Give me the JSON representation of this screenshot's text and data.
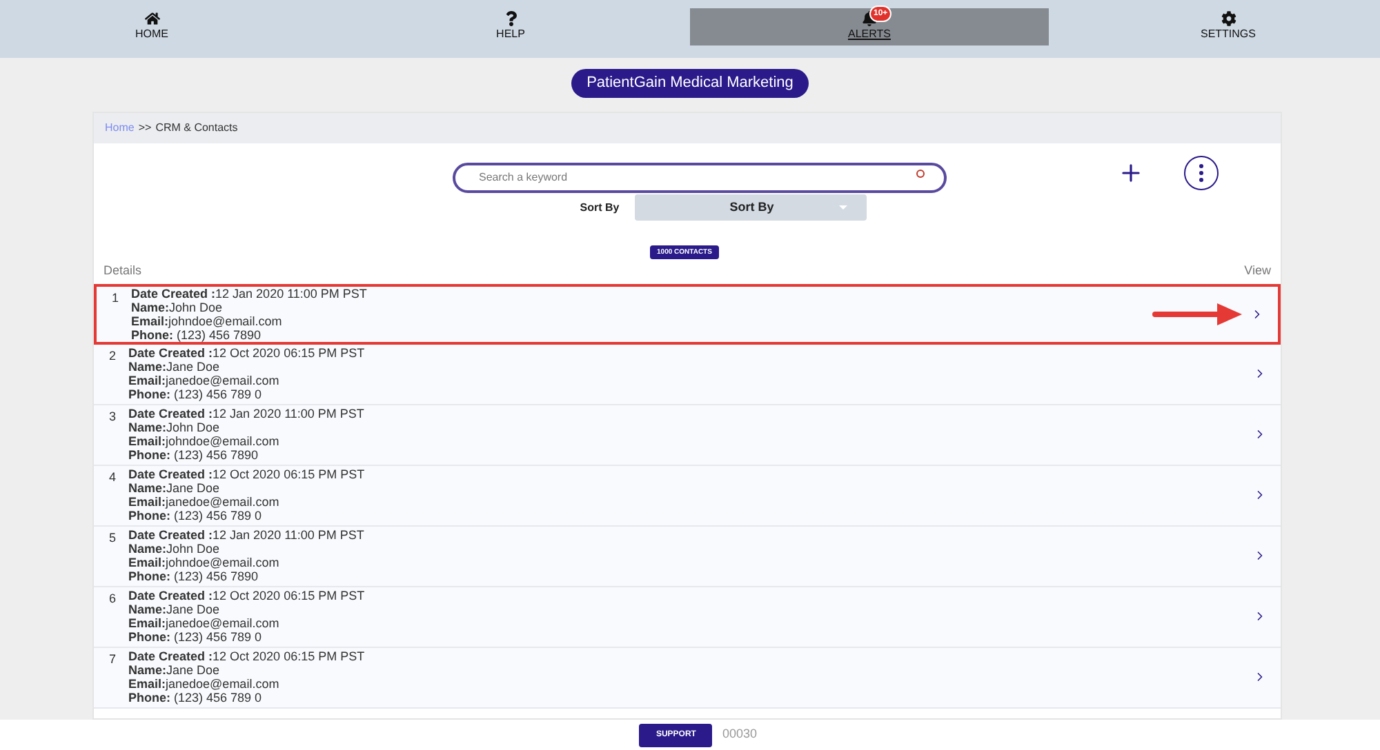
{
  "nav": [
    {
      "label": "HOME",
      "kind": "home",
      "selected": false
    },
    {
      "label": "HELP",
      "kind": "help",
      "selected": false
    },
    {
      "label": "ALERTS",
      "kind": "alerts",
      "selected": true,
      "badge": "10+"
    },
    {
      "label": "SETTINGS",
      "kind": "settings",
      "selected": false
    }
  ],
  "org_button": "PatientGain Medical Marketing",
  "breadcrumb": {
    "link": "Home",
    "separator": ">>",
    "current": "CRM & Contacts"
  },
  "search": {
    "placeholder": "Search a keyword"
  },
  "sort": {
    "label": "Sort By",
    "value": "Sort By"
  },
  "count_badge": "1000 CONTACTS",
  "columns": {
    "details": "Details",
    "view": "View"
  },
  "contacts": [
    {
      "index": "1",
      "date_label": "Date Created :",
      "date": "12 Jan 2020 11:00 PM PST",
      "name_label": "Name:",
      "name": "John Doe",
      "email_label": "Email:",
      "email": "johndoe@email.com",
      "phone_label": "Phone:",
      "phone": "(123) 456 7890",
      "selected": true
    },
    {
      "index": "2",
      "date_label": "Date Created :",
      "date": "12 Oct 2020 06:15 PM PST",
      "name_label": "Name:",
      "name": "Jane Doe",
      "email_label": "Email:",
      "email": "janedoe@email.com",
      "phone_label": "Phone:",
      "phone": "(123) 456 789 0",
      "selected": false
    },
    {
      "index": "3",
      "date_label": "Date Created :",
      "date": "12 Jan 2020 11:00 PM PST",
      "name_label": "Name:",
      "name": "John Doe",
      "email_label": "Email:",
      "email": "johndoe@email.com",
      "phone_label": "Phone:",
      "phone": "(123) 456 7890",
      "selected": false
    },
    {
      "index": "4",
      "date_label": "Date Created :",
      "date": "12 Oct 2020 06:15 PM PST",
      "name_label": "Name:",
      "name": "Jane Doe",
      "email_label": "Email:",
      "email": "janedoe@email.com",
      "phone_label": "Phone:",
      "phone": "(123) 456 789 0",
      "selected": false
    },
    {
      "index": "5",
      "date_label": "Date Created :",
      "date": "12 Jan 2020 11:00 PM PST",
      "name_label": "Name:",
      "name": "John Doe",
      "email_label": "Email:",
      "email": "johndoe@email.com",
      "phone_label": "Phone:",
      "phone": "(123) 456 7890",
      "selected": false
    },
    {
      "index": "6",
      "date_label": "Date Created :",
      "date": "12 Oct 2020 06:15 PM PST",
      "name_label": "Name:",
      "name": "Jane Doe",
      "email_label": "Email:",
      "email": "janedoe@email.com",
      "phone_label": "Phone:",
      "phone": "(123) 456 789 0",
      "selected": false
    },
    {
      "index": "7",
      "date_label": "Date Created :",
      "date": "12 Oct 2020 06:15 PM PST",
      "name_label": "Name:",
      "name": "Jane Doe",
      "email_label": "Email:",
      "email": "janedoe@email.com",
      "phone_label": "Phone:",
      "phone": "(123) 456 789 0",
      "selected": false
    }
  ],
  "footer": {
    "button": "SUPPORT",
    "code": "00030"
  }
}
